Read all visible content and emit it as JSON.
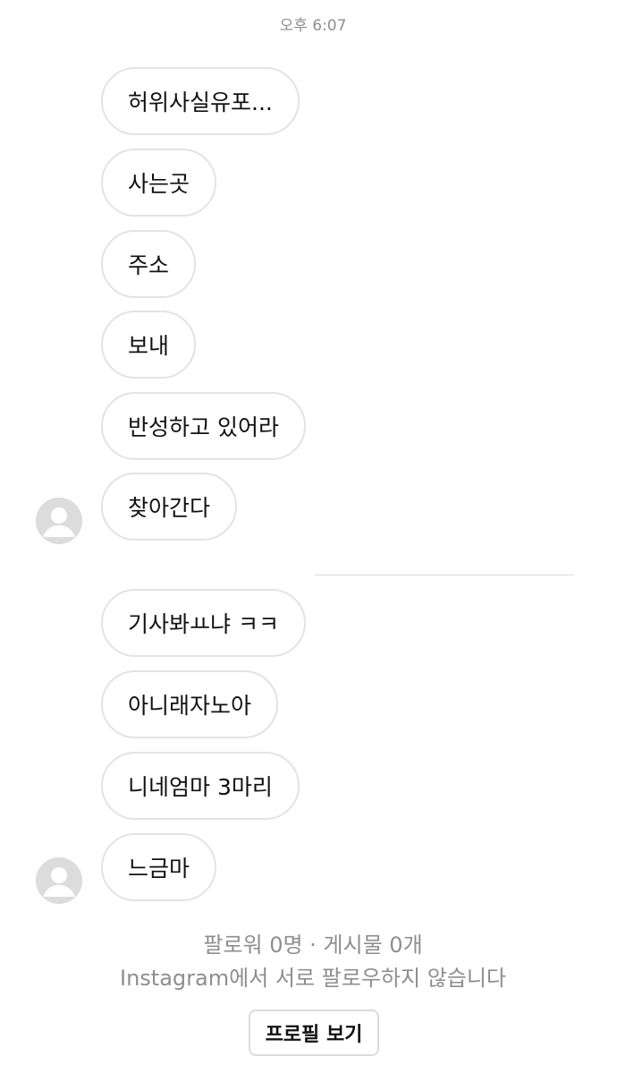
{
  "chat": {
    "timestamp": "오후 6:07",
    "group1": [
      "허위사실유포...",
      "사는곳",
      "주소",
      "보내",
      "반성하고 있어라",
      "찾아간다"
    ],
    "group2": [
      "기사봐ㅛ냐 ㅋㅋ",
      "아니래자노아",
      "니네엄마 3마리",
      "느금마"
    ]
  },
  "profile": {
    "stats": "팔로워 0명 · 게시물 0개",
    "relationship": "Instagram에서 서로 팔로우하지 않습니다",
    "view_profile_label": "프로필 보기"
  },
  "colors": {
    "bubble_border": "#e3e3e3",
    "secondary_text": "#8e8e8e",
    "avatar_bg": "#dcdcdc"
  }
}
